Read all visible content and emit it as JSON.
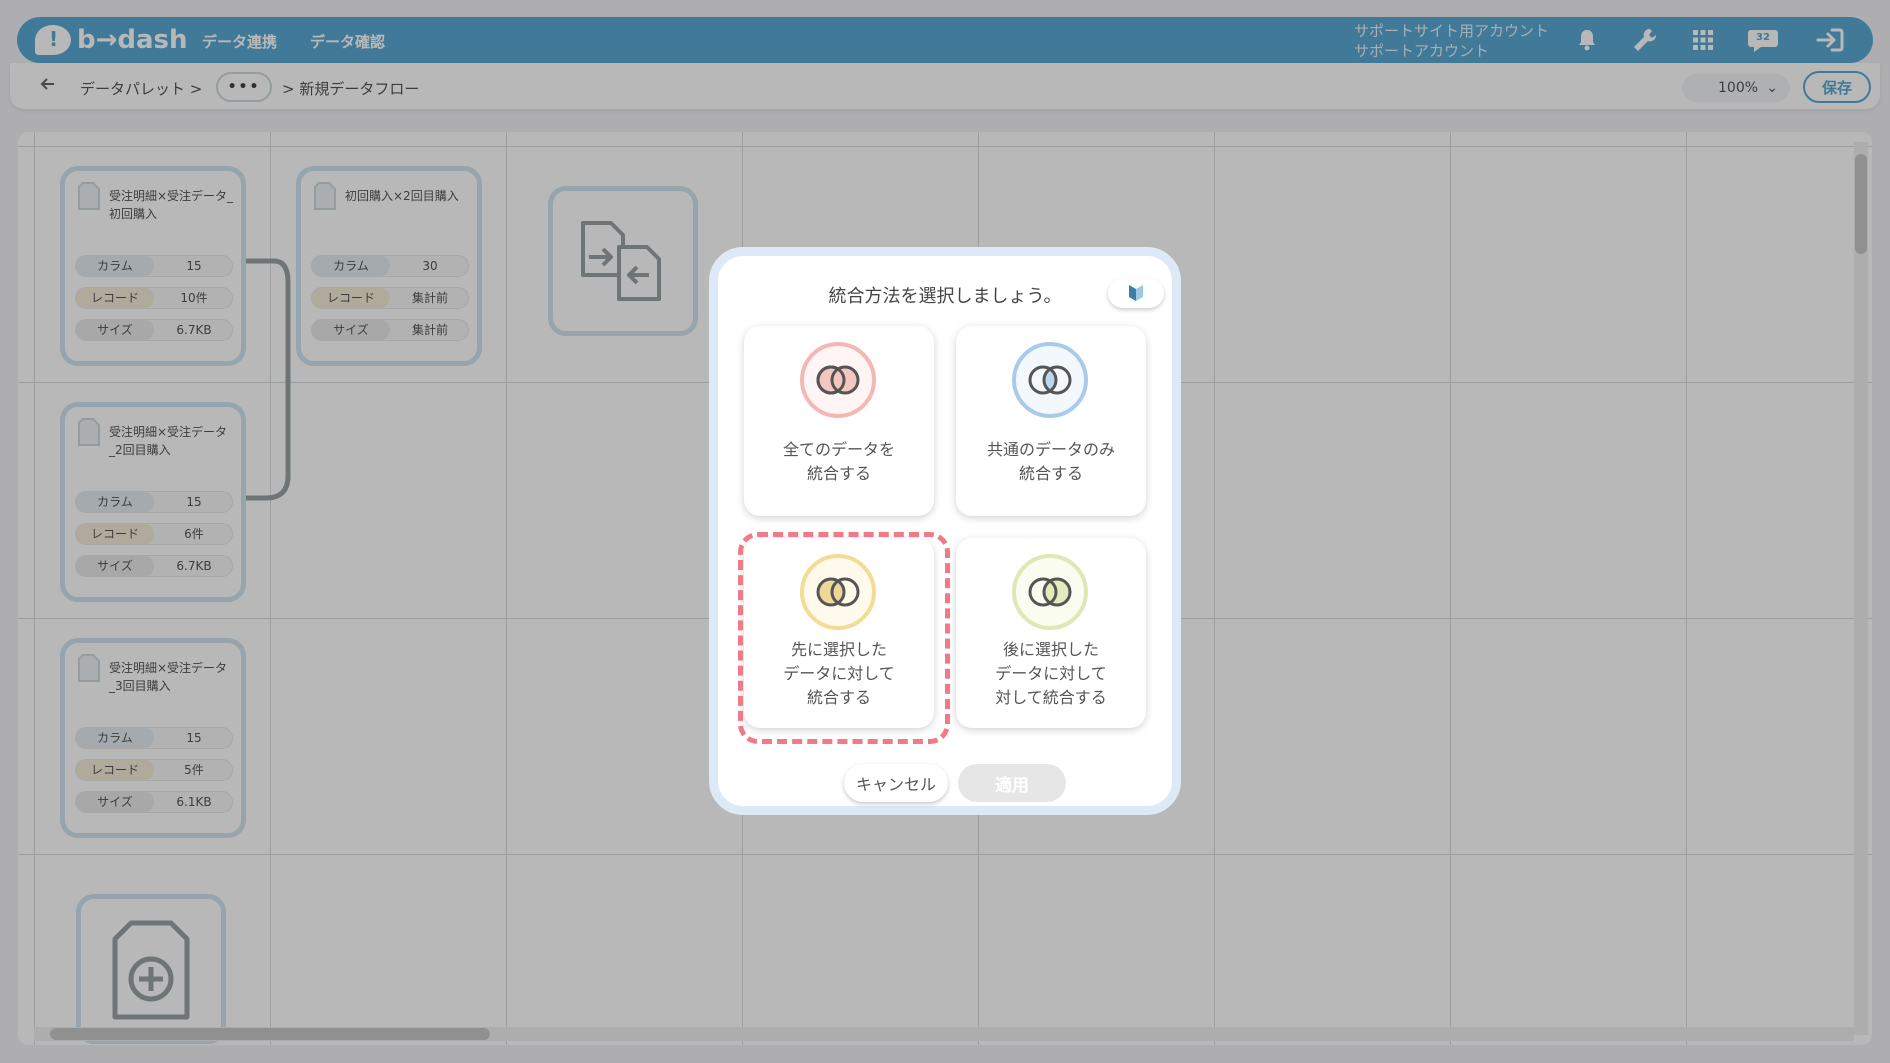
{
  "header": {
    "logo_text": "b→dash",
    "nav": [
      "データ連携",
      "データ確認"
    ],
    "account_line1": "サポートサイト用アカウント",
    "account_line2": "サポートアカウント",
    "notification_badge": "32"
  },
  "subbar": {
    "breadcrumb_root": "データパレット >",
    "breadcrumb_more": "•••",
    "breadcrumb_current": "> 新規データフロー",
    "zoom": "100%",
    "save_label": "保存"
  },
  "nodes": [
    {
      "title": "受注明細×受注データ_初回購入",
      "rows": [
        {
          "label": "カラム",
          "value": "15"
        },
        {
          "label": "レコード",
          "value": "10件"
        },
        {
          "label": "サイズ",
          "value": "6.7KB"
        }
      ]
    },
    {
      "title": "初回購入×2回目購入",
      "rows": [
        {
          "label": "カラム",
          "value": "30"
        },
        {
          "label": "レコード",
          "value": "集計前"
        },
        {
          "label": "サイズ",
          "value": "集計前"
        }
      ]
    },
    {
      "title": "受注明細×受注データ_2回目購入",
      "rows": [
        {
          "label": "カラム",
          "value": "15"
        },
        {
          "label": "レコード",
          "value": "6件"
        },
        {
          "label": "サイズ",
          "value": "6.7KB"
        }
      ]
    },
    {
      "title": "受注明細×受注データ_3回目購入",
      "rows": [
        {
          "label": "カラム",
          "value": "15"
        },
        {
          "label": "レコード",
          "value": "5件"
        },
        {
          "label": "サイズ",
          "value": "6.1KB"
        }
      ]
    }
  ],
  "modal": {
    "title": "統合方法を選択しましょう。",
    "options": [
      {
        "line1": "全てのデータを",
        "line2": "統合する",
        "line3": ""
      },
      {
        "line1": "共通のデータのみ",
        "line2": "統合する",
        "line3": ""
      },
      {
        "line1": "先に選択した",
        "line2": "データに対して",
        "line3": "統合する"
      },
      {
        "line1": "後に選択した",
        "line2": "データに対して",
        "line3": "対して統合する"
      }
    ],
    "selected_option": 2,
    "cancel_label": "キャンセル",
    "apply_label": "適用"
  },
  "colors": {
    "brand": "#5aa9d3",
    "option_all": "#f5b7b3",
    "option_common": "#a9cbe9",
    "option_left": "#f3dc94",
    "option_right": "#dfe7b6",
    "selected_dash": "#f07a85"
  }
}
